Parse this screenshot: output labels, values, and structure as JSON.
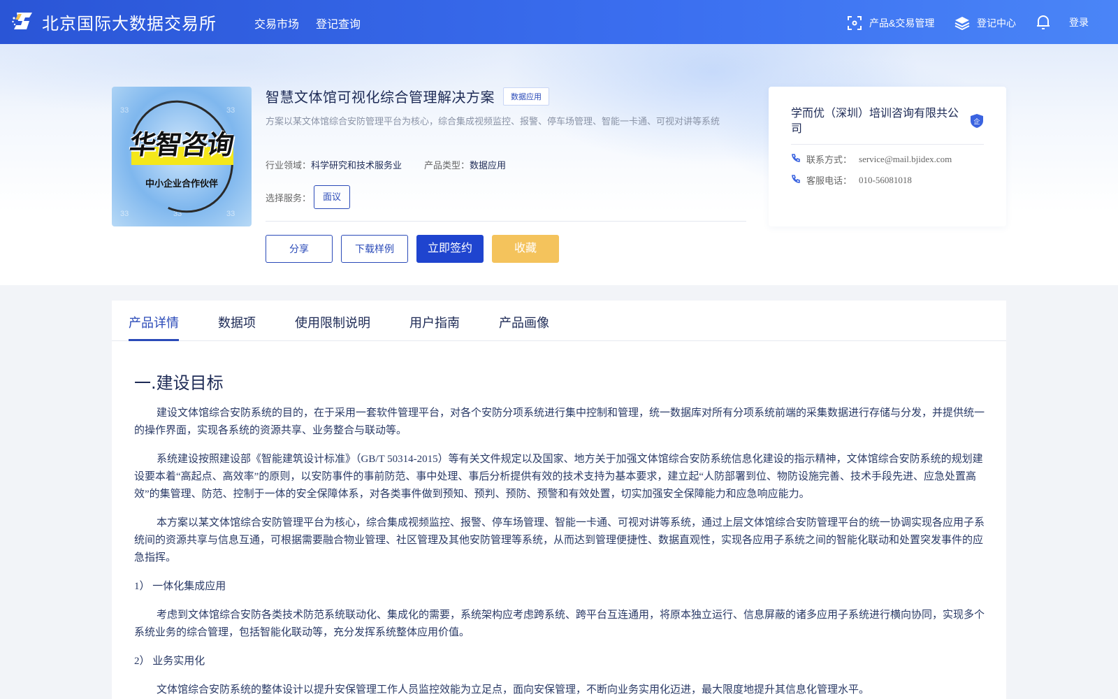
{
  "header": {
    "brand": "北京国际大数据交易所",
    "nav": [
      "交易市场",
      "登记查询"
    ],
    "right": {
      "product_mgmt": "产品&交易管理",
      "register_center": "登记中心",
      "login": "登录"
    }
  },
  "product": {
    "image_title": "华智咨询",
    "image_subtitle": "中小企业合作伙伴",
    "title": "智慧文体馆可视化综合管理解决方案",
    "tag": "数据应用",
    "description": "方案以某文体馆综合安防管理平台为核心，综合集成视频监控、报警、停车场管理、智能一卡通、可视对讲等系统",
    "industry_label": "行业领域：",
    "industry_value": "科学研究和技术服务业",
    "type_label": "产品类型：",
    "type_value": "数据应用",
    "service_label": "选择服务：",
    "service_option": "面议",
    "actions": {
      "share": "分享",
      "download": "下载样例",
      "sign": "立即签约",
      "favorite": "收藏"
    }
  },
  "vendor": {
    "name": "学而优（深圳）培训咨询有限共公司",
    "badge": "企",
    "contact_label": "联系方式：",
    "contact_value": "service@mail.bjidex.com",
    "phone_label": "客服电话：",
    "phone_value": "010-56081018"
  },
  "tabs": [
    "产品详情",
    "数据项",
    "使用限制说明",
    "用户指南",
    "产品画像"
  ],
  "article": {
    "heading": "一.建设目标",
    "p1": "建设文体馆综合安防系统的目的，在于采用一套软件管理平台，对各个安防分项系统进行集中控制和管理，统一数据库对所有分项系统前端的采集数据进行存储与分发，并提供统一的操作界面，实现各系统的资源共享、业务整合与联动等。",
    "p2": "系统建设按照建设部《智能建筑设计标准》（GB/T 50314-2015）等有关文件规定以及国家、地方关于加强文体馆综合安防系统信息化建设的指示精神，文体馆综合安防系统的规划建设要本着“高起点、高效率”的原则，以安防事件的事前防范、事中处理、事后分析提供有效的技术支持为基本要求，建立起“人防部署到位、物防设施完善、技术手段先进、应急处置高效”的集管理、防范、控制于一体的安全保障体系，对各类事件做到预知、预判、预防、预警和有效处置，切实加强安全保障能力和应急响应能力。",
    "p3": "本方案以某文体馆综合安防管理平台为核心，综合集成视频监控、报警、停车场管理、智能一卡通、可视对讲等系统，通过上层文体馆综合安防管理平台的统一协调实现各应用子系统间的资源共享与信息互通，可根据需要融合物业管理、社区管理及其他安防管理等系统，从而达到管理便捷性、数据直观性，实现各应用子系统之间的智能化联动和处置突发事件的应急指挥。",
    "item1": "1）  一体化集成应用",
    "p4": "考虑到文体馆综合安防各类技术防范系统联动化、集成化的需要，系统架构应考虑跨系统、跨平台互连通用，将原本独立运行、信息屏蔽的诸多应用子系统进行横向协同，实现多个系统业务的综合管理，包括智能化联动等，充分发挥系统整体应用价值。",
    "item2": "2）  业务实用化",
    "p5": "文体馆综合安防系统的整体设计以提升安保管理工作人员监控效能为立足点，面向安保管理，不断向业务实用化迈进，最大限度地提升其信息化管理水平。"
  }
}
